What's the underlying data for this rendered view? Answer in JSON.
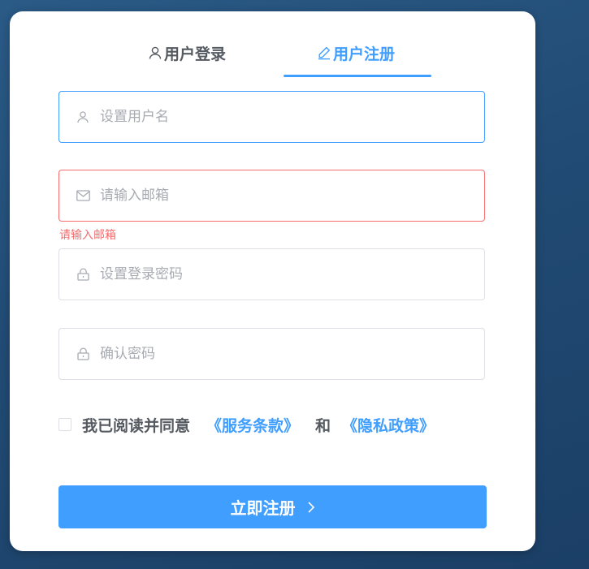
{
  "tabs": {
    "login_label": "用户登录",
    "register_label": "用户注册"
  },
  "form": {
    "username_placeholder": "设置用户名",
    "email_placeholder": "请输入邮箱",
    "email_error": "请输入邮箱",
    "password_placeholder": "设置登录密码",
    "confirm_placeholder": "确认密码"
  },
  "agreement": {
    "prefix": "我已阅读并同意",
    "terms_link": "《服务条款》",
    "conjunction": "和",
    "privacy_link": "《隐私政策》",
    "checked": false
  },
  "submit_label": "立即注册",
  "icons": {
    "login_tab": "user-icon",
    "register_tab": "edit-icon",
    "username": "user-icon",
    "email": "mail-icon",
    "password": "lock-icon",
    "confirm": "lock-icon",
    "submit": "chevron-right-icon"
  },
  "colors": {
    "primary": "#409eff",
    "error": "#f56c6c",
    "text": "#555a61",
    "placeholder": "#a8abb2",
    "background": "#214b74"
  }
}
